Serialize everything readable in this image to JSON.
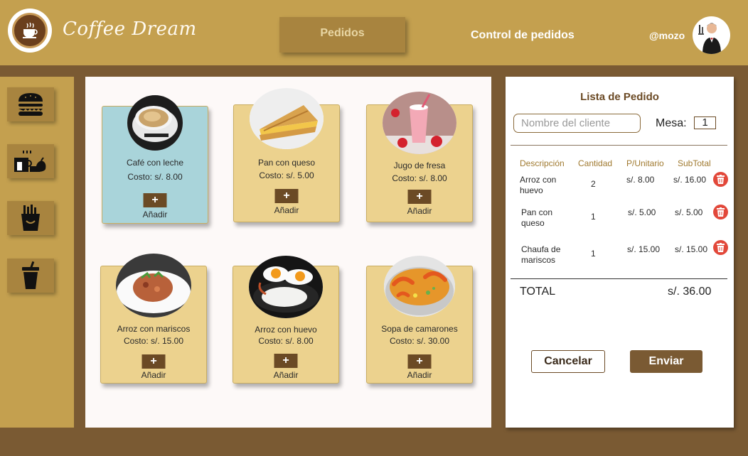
{
  "header": {
    "brand": "Coffee Dream",
    "tabs": [
      {
        "label": "Pedidos",
        "active": true
      },
      {
        "label": "Control de pedidos",
        "active": false
      }
    ],
    "username": "@mozo",
    "accent": "#c4a04f",
    "dark": "#7a5a33"
  },
  "sidebar": {
    "categories": [
      {
        "icon": "burger-icon"
      },
      {
        "icon": "breakfast-icon"
      },
      {
        "icon": "fries-icon"
      },
      {
        "icon": "drink-cup-icon"
      }
    ]
  },
  "products": [
    {
      "name": "Café con leche",
      "price": "Costo: s/. 8.00",
      "add_label": "Añadir",
      "add_symbol": "+",
      "selected": true
    },
    {
      "name": "Pan con queso",
      "price": "Costo: s/. 5.00",
      "add_label": "Añadir",
      "add_symbol": "+"
    },
    {
      "name": "Jugo de fresa",
      "price": "Costo: s/. 8.00",
      "add_label": "Añadir",
      "add_symbol": "+"
    },
    {
      "name": "Arroz con mariscos",
      "price": "Costo: s/. 15.00",
      "add_label": "Añadir",
      "add_symbol": "+"
    },
    {
      "name": "Arroz con huevo",
      "price": "Costo: s/. 8.00",
      "add_label": "Añadir",
      "add_symbol": "+"
    },
    {
      "name": "Sopa de camarones",
      "price": "Costo: s/. 30.00",
      "add_label": "Añadir",
      "add_symbol": "+"
    }
  ],
  "order": {
    "title": "Lista de Pedido",
    "client_placeholder": "Nombre del cliente",
    "table_label": "Mesa:",
    "table_value": "1",
    "columns": [
      "Descripción",
      "Cantidad",
      "P/Unitario",
      "SubTotal"
    ],
    "items": [
      {
        "description": "Arroz con huevo",
        "quantity": "2",
        "unit_price": "s/. 8.00",
        "subtotal": "s/. 16.00"
      },
      {
        "description": "Pan con queso",
        "quantity": "1",
        "unit_price": "s/. 5.00",
        "subtotal": "s/. 5.00"
      },
      {
        "description": "Chaufa de mariscos",
        "quantity": "1",
        "unit_price": "s/. 15.00",
        "subtotal": "s/. 15.00"
      }
    ],
    "total_label": "TOTAL",
    "total_value": "s/. 36.00",
    "cancel_label": "Cancelar",
    "send_label": "Enviar"
  }
}
